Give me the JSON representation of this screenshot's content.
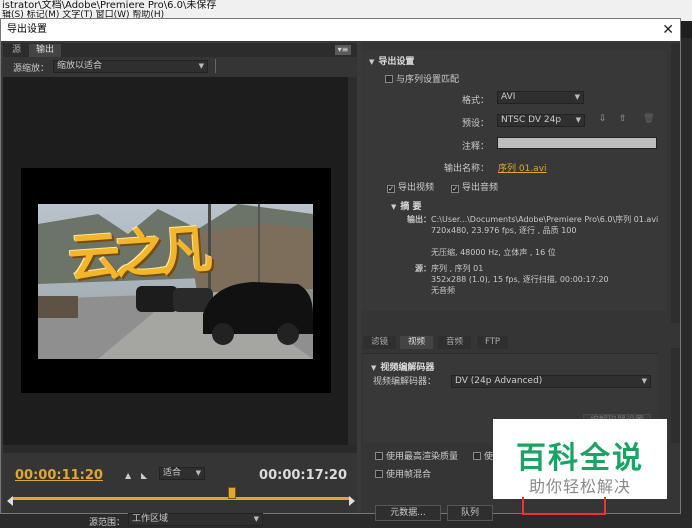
{
  "app": {
    "title": "istrator\\文档\\Adobe\\Premiere Pro\\6.0\\未保存",
    "menu": "辑(S)    标记(M)    文字(T)    窗口(W)    帮助(H)"
  },
  "dialog": {
    "title": "导出设置",
    "close_symbol": "✕"
  },
  "left": {
    "tabs": [
      {
        "label": "源"
      },
      {
        "label": "输出"
      }
    ],
    "panel_menu_symbol": "▾≡",
    "source_scaling": {
      "label": "源缩放：",
      "value": "缩放以适合"
    },
    "title_art": "云之凡",
    "timecode_in": "00:00:11:20",
    "timecode_out": "00:00:17:20",
    "fit": {
      "value": "适合"
    },
    "playhead_percent": 65,
    "source_range": {
      "label": "源范围：",
      "value": "工作区域"
    }
  },
  "right": {
    "export_settings_header": "导出设置",
    "match_sequence": "与序列设置匹配",
    "format": {
      "label": "格式：",
      "value": "AVI"
    },
    "preset": {
      "label": "预设：",
      "value": "NTSC DV 24p"
    },
    "comments": {
      "label": "注释：",
      "value": ""
    },
    "output_name": {
      "label": "输出名称：",
      "value": "序列 01.avi"
    },
    "export_video": "导出视频",
    "export_audio": "导出音频",
    "summary": {
      "header": "摘 要",
      "output_label": "输出：",
      "output_lines": [
        "C:\\User...\\Documents\\Adobe\\Premiere Pro\\6.0\\序列 01.avi",
        "720x480, 23.976 fps, 逐行 , 品质 100",
        "",
        "无压缩, 48000 Hz, 立体声 , 16 位"
      ],
      "source_label": "源：",
      "source_lines": [
        "序列 , 序列 01",
        "352x288 (1.0), 15 fps, 逐行扫描, 00:00:17:20",
        "无音频"
      ]
    },
    "subtabs": [
      {
        "label": "滤镜"
      },
      {
        "label": "视频"
      },
      {
        "label": "音频"
      },
      {
        "label": "FTP"
      }
    ],
    "video_codec_header": "视频编解码器",
    "video_codec": {
      "label": "视频编解码器：",
      "value": "DV (24p Advanced)"
    },
    "codec_settings_button": "编解码器设置",
    "use_max_render": "使用最高渲染质量",
    "use_cut": "使",
    "use_frame_blend": "使用帧混合",
    "metadata_button": "元数据...",
    "queue_button": "队列"
  },
  "watermark": {
    "title": "百科全说",
    "subtitle": "助你轻松解决"
  }
}
